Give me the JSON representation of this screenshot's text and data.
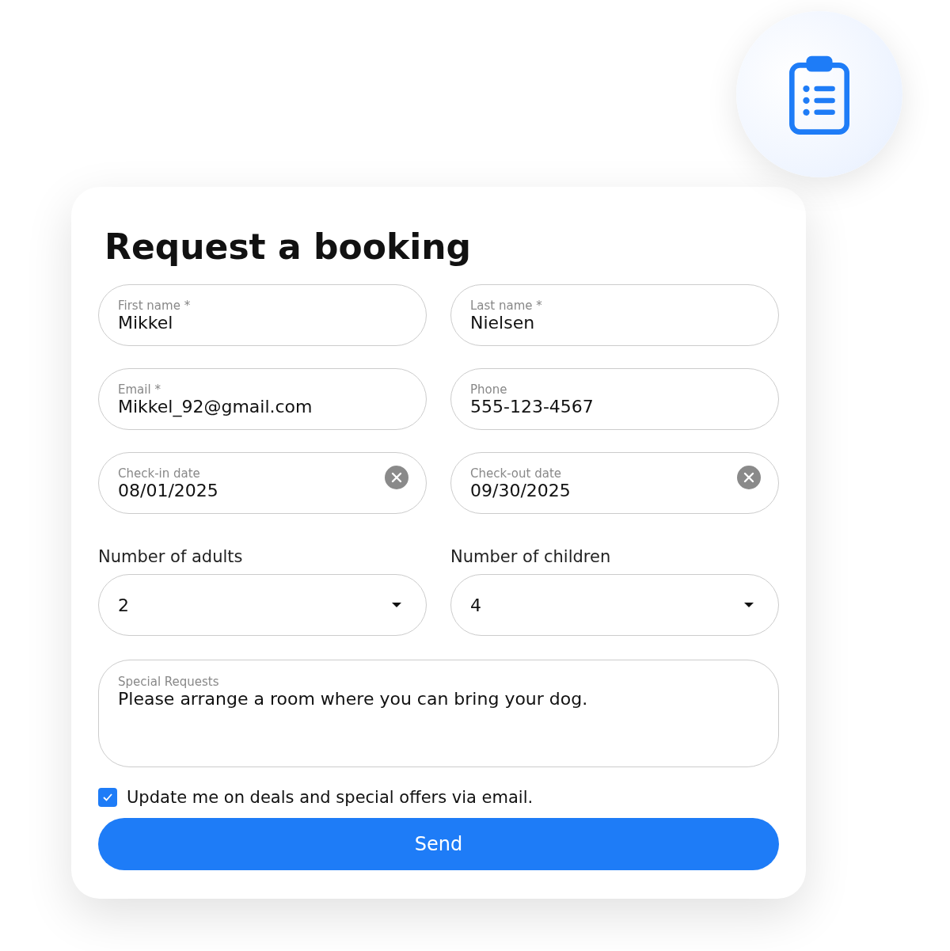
{
  "title": "Request a booking",
  "fields": [
    {
      "kind": "text",
      "label": "First name *",
      "value": "Mikkel"
    },
    {
      "kind": "text",
      "label": "Last name *",
      "value": "Nielsen"
    },
    {
      "kind": "text",
      "label": "Email *",
      "value": "Mikkel_92@gmail.com"
    },
    {
      "kind": "text",
      "label": "Phone",
      "value": "555-123-4567"
    },
    {
      "kind": "date",
      "label": "Check-in date",
      "value": "08/01/2025"
    },
    {
      "kind": "date",
      "label": "Check-out date",
      "value": "09/30/2025"
    },
    {
      "kind": "select",
      "label": "Number of adults",
      "value": "2"
    },
    {
      "kind": "select",
      "label": "Number of children",
      "value": "4"
    }
  ],
  "special_requests": {
    "label": "Special Requests",
    "value": "Please arrange a room where you can bring your dog."
  },
  "newsletter": {
    "label": "Update me on deals and special offers via email.",
    "checked": true
  },
  "send_button": "Send"
}
